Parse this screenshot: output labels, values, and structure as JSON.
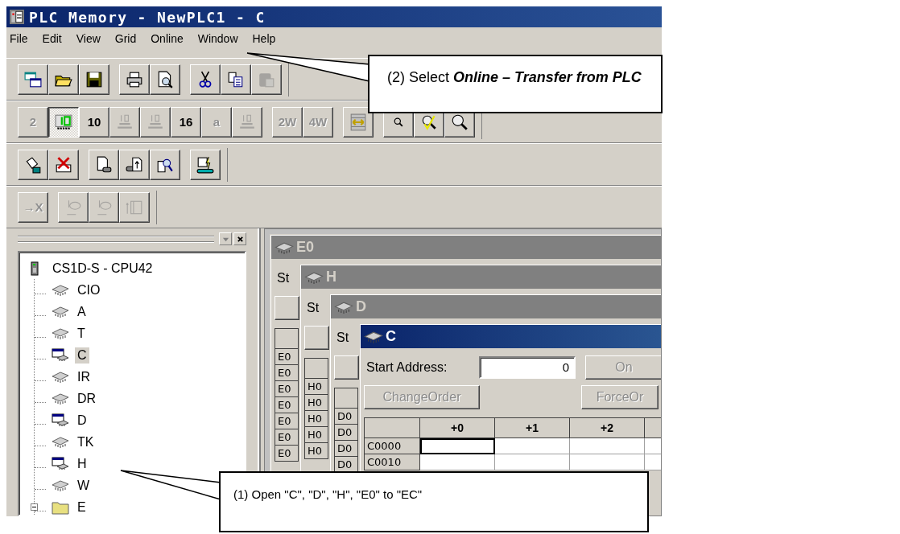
{
  "window": {
    "title": "PLC Memory - NewPLC1 - C"
  },
  "menu": [
    "File",
    "Edit",
    "View",
    "Grid",
    "Online",
    "Window",
    "Help"
  ],
  "toolbars": [
    [
      [
        {
          "disabled": false,
          "pressed": false
        },
        {
          "disabled": false,
          "pressed": false
        },
        {
          "disabled": false,
          "pressed": false
        }
      ],
      [
        {
          "disabled": false,
          "pressed": false
        },
        {
          "disabled": false,
          "pressed": false
        }
      ],
      [
        {
          "disabled": false,
          "pressed": false
        },
        {
          "disabled": false,
          "pressed": false
        },
        {
          "disabled": true,
          "pressed": false
        }
      ]
    ],
    [
      [
        {
          "label": "2",
          "disabled": true,
          "pressed": false
        },
        {
          "disabled": false,
          "pressed": true
        },
        {
          "label": "10",
          "disabled": false,
          "pressed": false
        },
        {
          "disabled": true,
          "pressed": false
        },
        {
          "disabled": true,
          "pressed": false
        },
        {
          "label": "16",
          "disabled": false,
          "pressed": false
        },
        {
          "label": "a",
          "disabled": true,
          "pressed": false
        },
        {
          "disabled": true,
          "pressed": false
        }
      ],
      [
        {
          "label": "2W",
          "disabled": true,
          "pressed": false
        },
        {
          "label": "4W",
          "disabled": true,
          "pressed": false
        }
      ],
      [
        {
          "disabled": false,
          "pressed": false
        }
      ],
      [
        {
          "disabled": false,
          "pressed": false
        },
        {
          "disabled": false,
          "pressed": false
        },
        {
          "disabled": false,
          "pressed": false
        }
      ]
    ],
    [
      [
        {
          "disabled": false,
          "pressed": false
        },
        {
          "disabled": false,
          "pressed": false
        }
      ],
      [
        {
          "disabled": false,
          "pressed": false
        },
        {
          "disabled": false,
          "pressed": false
        },
        {
          "disabled": false,
          "pressed": false
        }
      ],
      [
        {
          "disabled": false,
          "pressed": false
        }
      ]
    ],
    [
      [
        {
          "label": "→X",
          "disabled": true,
          "pressed": false
        }
      ],
      [
        {
          "disabled": true,
          "pressed": false
        },
        {
          "disabled": true,
          "pressed": false
        },
        {
          "disabled": true,
          "pressed": false
        }
      ]
    ]
  ],
  "tree": {
    "label": "CS1D-S - CPU42",
    "children": [
      {
        "kind": "memory",
        "label": "CIO",
        "open": false,
        "selected": false
      },
      {
        "kind": "memory",
        "label": "A",
        "open": false,
        "selected": false
      },
      {
        "kind": "memory",
        "label": "T",
        "open": false,
        "selected": false
      },
      {
        "kind": "memory",
        "label": "C",
        "open": true,
        "selected": true
      },
      {
        "kind": "memory",
        "label": "IR",
        "open": false,
        "selected": false
      },
      {
        "kind": "memory",
        "label": "DR",
        "open": false,
        "selected": false
      },
      {
        "kind": "memory",
        "label": "D",
        "open": true,
        "selected": false
      },
      {
        "kind": "memory",
        "label": "TK",
        "open": false,
        "selected": false
      },
      {
        "kind": "memory",
        "label": "H",
        "open": true,
        "selected": false
      },
      {
        "kind": "memory",
        "label": "W",
        "open": false,
        "selected": false
      },
      {
        "kind": "folder",
        "label": "E",
        "expanded": true,
        "selected": false
      }
    ]
  },
  "memory_windows": [
    {
      "title": "E0",
      "active": false,
      "start_label": "St",
      "rows": [
        {
          "address": "E0",
          "selected": false
        },
        {
          "address": "E0",
          "selected": false
        },
        {
          "address": "E0",
          "selected": false
        },
        {
          "address": "E0",
          "selected": false
        },
        {
          "address": "E0",
          "selected": false
        },
        {
          "address": "E0",
          "selected": false
        },
        {
          "address": "E0",
          "selected": false
        }
      ]
    },
    {
      "title": "H",
      "active": false,
      "start_label": "St",
      "rows": [
        {
          "address": "H0",
          "selected": false
        },
        {
          "address": "H0",
          "selected": false
        },
        {
          "address": "H0",
          "selected": false
        },
        {
          "address": "H0",
          "selected": false
        },
        {
          "address": "H0",
          "selected": false
        }
      ]
    },
    {
      "title": "D",
      "active": false,
      "start_label": "St",
      "rows": [
        {
          "address": "D0",
          "selected": false
        },
        {
          "address": "D0",
          "selected": false
        },
        {
          "address": "D0",
          "selected": false
        },
        {
          "address": "D0",
          "selected": false
        }
      ]
    },
    {
      "title": "C",
      "active": true,
      "start_label": "Start Address:",
      "start_address": "0",
      "buttons": [
        {
          "label": "On",
          "disabled": true
        },
        {
          "label": "ChangeOrder",
          "disabled": true
        },
        {
          "label": "ForceOr",
          "disabled": true
        }
      ],
      "columns": [
        "+0",
        "+1",
        "+2"
      ],
      "rows": [
        {
          "address": "C0000",
          "selected": true
        },
        {
          "address": "C0010",
          "selected": false
        }
      ]
    }
  ],
  "callouts": [
    {
      "text": "(2) Select **Online – Transfer from PLC**"
    },
    {
      "text": "(1) Open \"C\", \"D\", \"H\", \"E0\" to \"EC\""
    }
  ]
}
